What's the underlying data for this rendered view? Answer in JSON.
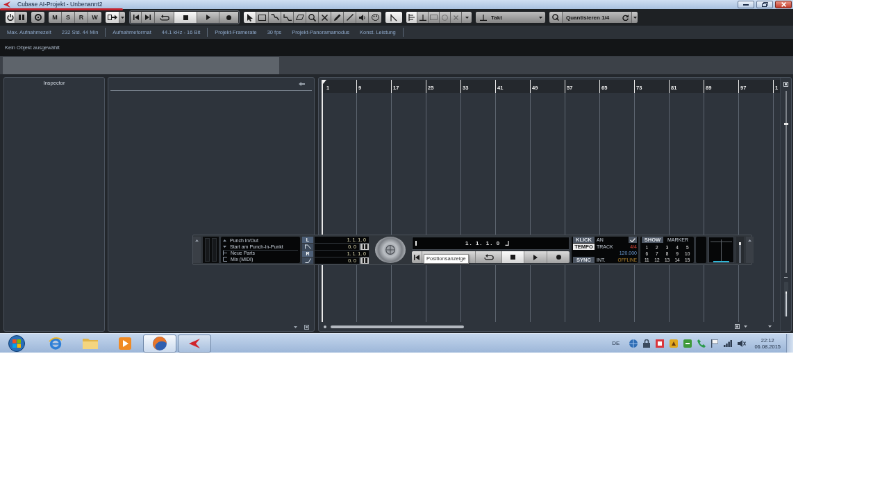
{
  "window": {
    "title": "Cubase AI-Projekt - Unbenannt2"
  },
  "toolbar": {
    "project_buttons": [
      {
        "kind": "activate",
        "on": true
      },
      {
        "kind": "constrain-delay",
        "on": false
      }
    ],
    "monitor_button": {
      "on": false
    },
    "automation_buttons": [
      "M",
      "S",
      "R",
      "W"
    ],
    "auto_scroll": {
      "on": true
    },
    "transport_buttons": [
      {
        "kind": "go-start",
        "on": false
      },
      {
        "kind": "go-end",
        "on": false
      },
      {
        "kind": "cycle",
        "on": false
      },
      {
        "kind": "stop",
        "on": true
      },
      {
        "kind": "play",
        "on": false
      },
      {
        "kind": "record",
        "on": false
      }
    ],
    "tools": [
      {
        "kind": "object-select",
        "selected": true
      },
      {
        "kind": "range",
        "selected": false
      },
      {
        "kind": "split",
        "selected": false
      },
      {
        "kind": "glue",
        "selected": false
      },
      {
        "kind": "erase",
        "selected": false
      },
      {
        "kind": "zoom",
        "selected": false
      },
      {
        "kind": "mute",
        "selected": false
      },
      {
        "kind": "draw",
        "selected": false
      },
      {
        "kind": "line",
        "selected": false
      },
      {
        "kind": "play",
        "selected": false
      },
      {
        "kind": "color",
        "selected": false
      }
    ],
    "snap": {
      "on": true
    },
    "snap_modes": [
      {
        "kind": "grid",
        "selected": true,
        "disabled": false
      },
      {
        "kind": "grid-relative",
        "selected": false,
        "disabled": false
      },
      {
        "kind": "events",
        "selected": false,
        "disabled": true
      },
      {
        "kind": "shuffle",
        "selected": false,
        "disabled": true
      },
      {
        "kind": "magnetic-cursor",
        "selected": false,
        "disabled": true
      }
    ],
    "grid_type": "Takt",
    "quantize_preset": "Quantisieren 1/4"
  },
  "status_line": [
    [
      {
        "label": "Max. Aufnahmezeit",
        "value": "232 Std. 44 Min"
      }
    ],
    [
      {
        "label": "Aufnahmeformat",
        "value": "44.1 kHz - 16 Bit"
      }
    ],
    [
      {
        "label": "Projekt-Framerate",
        "value": "30 fps"
      },
      {
        "label": "Projekt-Panoramamodus",
        "value": "Konst. Leistung"
      }
    ]
  ],
  "info_line": {
    "text": "Kein Objekt ausgewählt"
  },
  "inspector": {
    "title": "Inspector"
  },
  "ruler": {
    "marks": [
      "1",
      "9",
      "17",
      "25",
      "33",
      "41",
      "49",
      "57",
      "65",
      "73",
      "81",
      "89",
      "97",
      "1"
    ]
  },
  "project": {
    "vertical_zoom": {
      "level": 0.73
    }
  },
  "transport": {
    "record_modes": [
      "Punch In/Out",
      "Start am Punch-In-Punkt",
      "Neue Parts",
      "Mix (MIDI)"
    ],
    "locators": [
      {
        "label": "L",
        "position": "1. 1. 1. 0",
        "offset": "0. 0"
      },
      {
        "label": "R",
        "position": "1. 1. 1. 0",
        "offset": "0. 0"
      }
    ],
    "position": "1. 1. 1. 0",
    "buttons": [
      {
        "kind": "go-start",
        "on": false
      },
      {
        "kind": "cycle",
        "on": false
      },
      {
        "kind": "stop",
        "on": true
      },
      {
        "kind": "play",
        "on": false
      },
      {
        "kind": "record",
        "on": false
      }
    ],
    "tooltip": "Positionsanzeige",
    "click": {
      "label": "KLICK",
      "value": "AN",
      "checked": true
    },
    "tempo": {
      "label": "TEMPO",
      "mode": "TRACK",
      "signature": "4/4",
      "bpm": "120.000",
      "on": true
    },
    "sync": {
      "label": "SYNC",
      "source": "INT.",
      "status": "OFFLINE"
    },
    "markers": {
      "label": "SHOW",
      "title": "MARKER",
      "numbers": [
        "1",
        "2",
        "3",
        "4",
        "5",
        "6",
        "7",
        "8",
        "9",
        "10",
        "11",
        "12",
        "13",
        "14",
        "15"
      ]
    },
    "output_meter": {
      "level": 0.05
    },
    "master_fader": {
      "level": 0.78
    }
  },
  "taskbar": {
    "apps": [
      {
        "kind": "browser",
        "running": false,
        "selected": false
      },
      {
        "kind": "files",
        "running": false,
        "selected": false
      },
      {
        "kind": "media",
        "running": false,
        "selected": false
      },
      {
        "kind": "web",
        "running": true,
        "selected": true
      },
      {
        "kind": "daw",
        "running": true,
        "selected": false
      }
    ],
    "language": "DE",
    "time": "22:12",
    "date": "06.08.2015"
  }
}
